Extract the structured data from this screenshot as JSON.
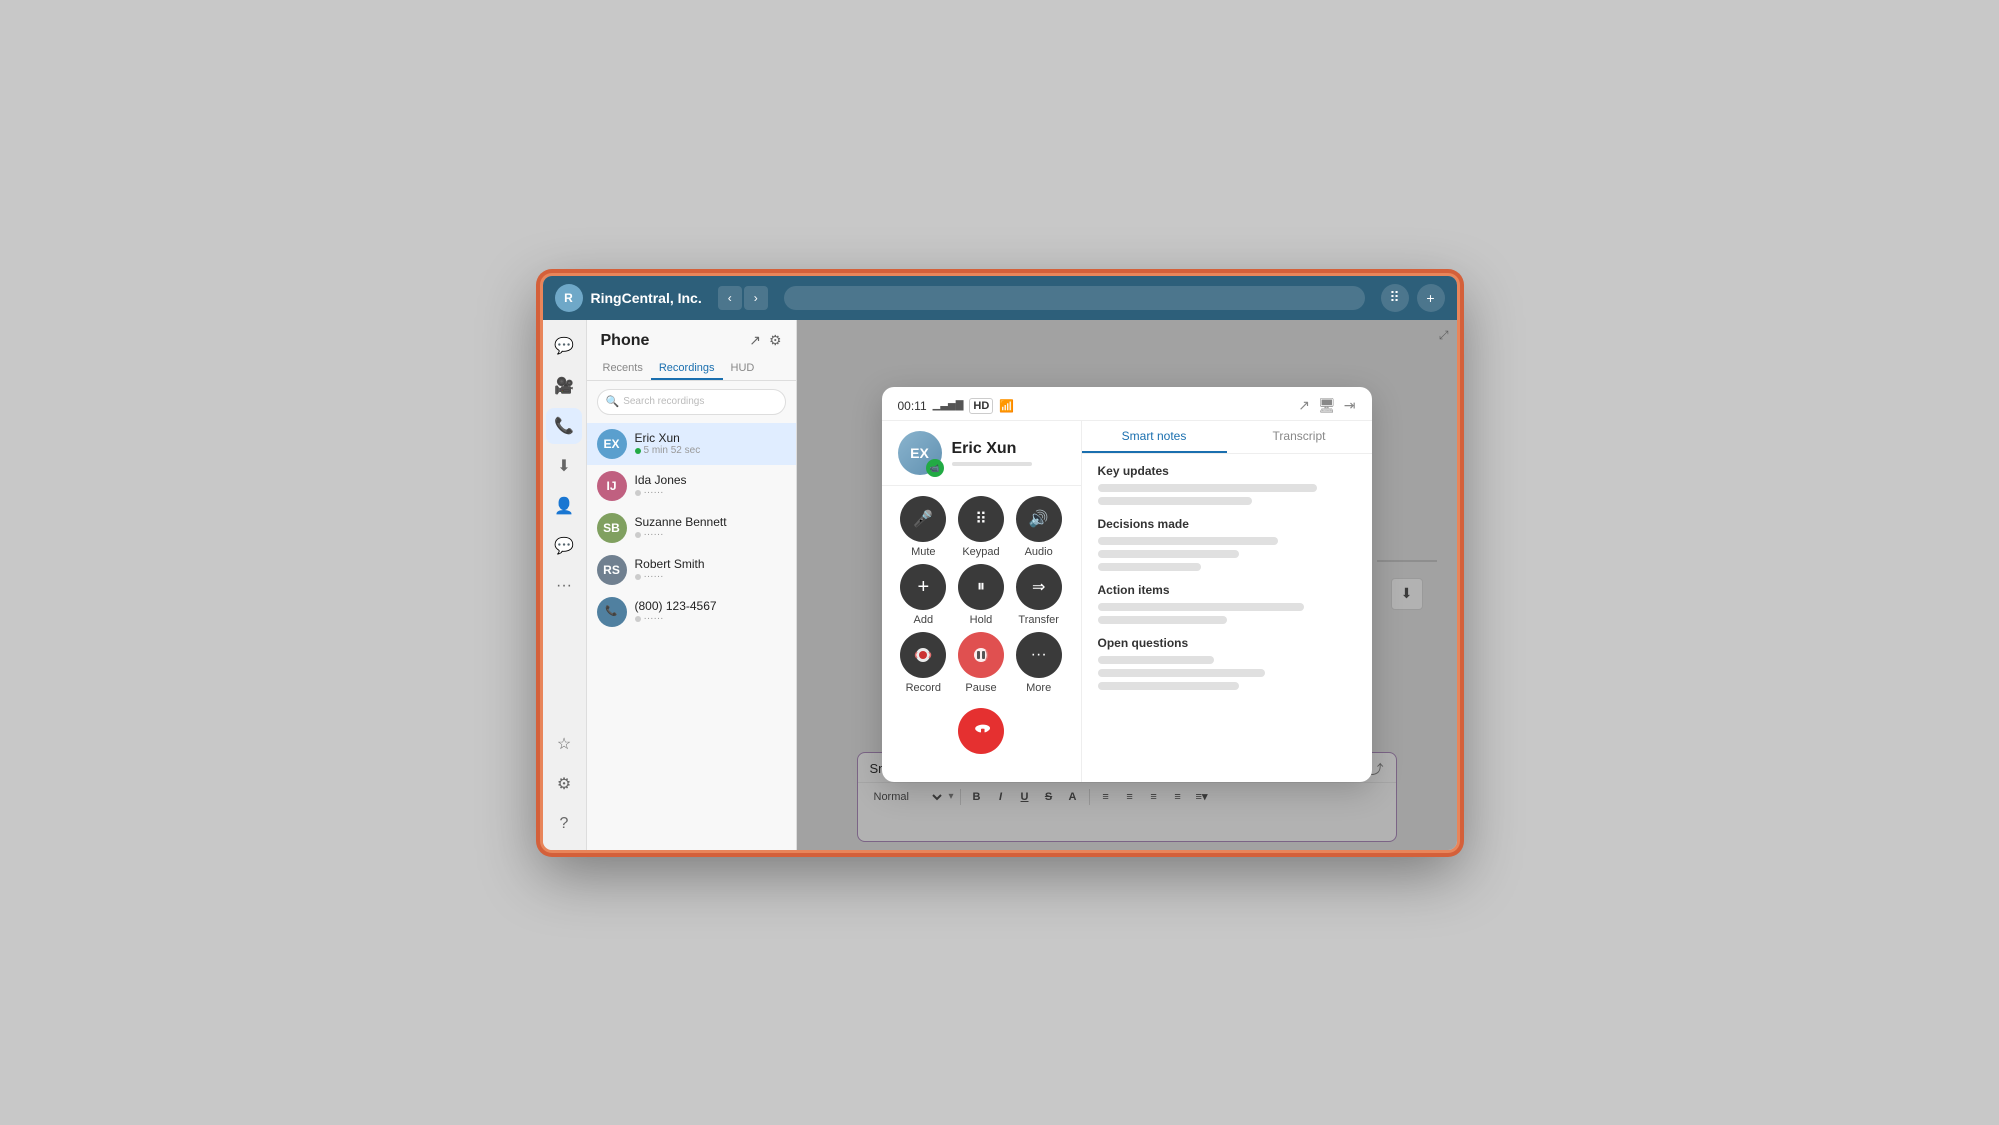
{
  "app": {
    "title": "RingCentral, Inc.",
    "company": "RingCentral, Inc."
  },
  "sidebar": {
    "icons": [
      {
        "name": "message-icon",
        "symbol": "💬",
        "active": false
      },
      {
        "name": "video-icon",
        "symbol": "📹",
        "active": false
      },
      {
        "name": "phone-icon",
        "symbol": "📞",
        "active": true
      },
      {
        "name": "download-icon",
        "symbol": "⬇",
        "active": false
      },
      {
        "name": "contacts-icon",
        "symbol": "👤",
        "active": false
      },
      {
        "name": "chat-icon",
        "symbol": "💬",
        "active": false
      },
      {
        "name": "apps-icon",
        "symbol": "🔲",
        "active": false
      }
    ],
    "bottom_icons": [
      {
        "name": "star-icon",
        "symbol": "☆"
      },
      {
        "name": "settings-icon",
        "symbol": "⚙"
      },
      {
        "name": "help-icon",
        "symbol": "?"
      }
    ]
  },
  "phone": {
    "title": "Phone",
    "tabs": [
      {
        "label": "Recents",
        "active": false
      },
      {
        "label": "HUD",
        "active": false
      },
      {
        "label": "Recordings",
        "active": true
      }
    ],
    "search_placeholder": "Search recordings",
    "contacts": [
      {
        "name": "Eric Xun",
        "status": "5 min 52 sec",
        "color": "#5a9fce",
        "initials": "EX",
        "active": true
      },
      {
        "name": "Ida Jones",
        "status": "······",
        "color": "#c06080",
        "initials": "IJ"
      },
      {
        "name": "Suzanne Bennett",
        "status": "······",
        "color": "#80a060",
        "initials": "SB"
      },
      {
        "name": "Robert Smith",
        "status": "······",
        "color": "#708090",
        "initials": "RS"
      },
      {
        "name": "(800) 123-4567",
        "status": "······",
        "color": "#5080a0",
        "initials": "📞"
      }
    ]
  },
  "call_dialog": {
    "time": "00:11",
    "quality_bars": "▁▃▅▇",
    "hd_label": "HD",
    "caller_name": "Eric Xun",
    "tabs": [
      {
        "label": "Smart notes",
        "active": true
      },
      {
        "label": "Transcript",
        "active": false
      }
    ],
    "buttons": [
      {
        "label": "Mute",
        "icon": "🎤",
        "name": "mute-button"
      },
      {
        "label": "Keypad",
        "icon": "⠿",
        "name": "keypad-button"
      },
      {
        "label": "Audio",
        "icon": "🔊",
        "name": "audio-button"
      },
      {
        "label": "Add",
        "icon": "+",
        "name": "add-button"
      },
      {
        "label": "Hold",
        "icon": "⏸",
        "name": "hold-button"
      },
      {
        "label": "Transfer",
        "icon": "⇒",
        "name": "transfer-button"
      },
      {
        "label": "Record",
        "icon": "⏺",
        "name": "record-button"
      },
      {
        "label": "Pause",
        "icon": "⏯",
        "name": "pause-button"
      },
      {
        "label": "More",
        "icon": "···",
        "name": "more-button"
      }
    ],
    "end_call_label": "End call"
  },
  "smart_notes": {
    "title": "Smart notes",
    "sections": [
      {
        "title": "Key updates",
        "lines": [
          {
            "width": "85%"
          },
          {
            "width": "60%"
          }
        ]
      },
      {
        "title": "Decisions made",
        "lines": [
          {
            "width": "70%"
          },
          {
            "width": "55%"
          },
          {
            "width": "40%"
          }
        ]
      },
      {
        "title": "Action items",
        "lines": [
          {
            "width": "80%"
          },
          {
            "width": "50%"
          }
        ]
      },
      {
        "title": "Open questions",
        "lines": [
          {
            "width": "45%"
          },
          {
            "width": "65%"
          },
          {
            "width": "55%"
          }
        ]
      }
    ]
  },
  "notes_bar": {
    "title": "Smart notes",
    "toolbar": {
      "format_label": "Normal",
      "buttons": [
        "B",
        "I",
        "U",
        "S",
        "A",
        "≡",
        "≡",
        "≡",
        "≡",
        "≡"
      ]
    }
  }
}
